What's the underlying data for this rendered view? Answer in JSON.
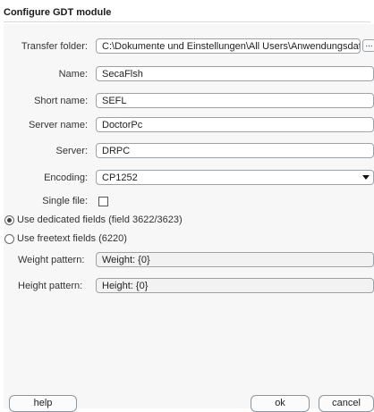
{
  "title": "Configure GDT module",
  "fields": {
    "transfer_folder": {
      "label": "Transfer folder:",
      "value": "C:\\Dokumente und Einstellungen\\All Users\\Anwendungsdaten",
      "browse_label": "..."
    },
    "name": {
      "label": "Name:",
      "value": "SecaFlsh"
    },
    "short_name": {
      "label": "Short name:",
      "value": "SEFL"
    },
    "server_name": {
      "label": "Server name:",
      "value": "DoctorPc"
    },
    "server": {
      "label": "Server:",
      "value": "DRPC"
    },
    "encoding": {
      "label": "Encoding:",
      "value": "CP1252"
    },
    "single_file": {
      "label": "Single file:",
      "checked": false
    }
  },
  "radios": [
    {
      "label": "Use dedicated fields (field 3622/3623)",
      "selected": true
    },
    {
      "label": "Use freetext fields (6220)",
      "selected": false
    }
  ],
  "patterns": {
    "weight": {
      "label": "Weight pattern:",
      "value": "Weight: {0}"
    },
    "height": {
      "label": "Height pattern:",
      "value": "Height: {0}"
    }
  },
  "buttons": {
    "help": "help",
    "ok": "ok",
    "cancel": "cancel"
  }
}
